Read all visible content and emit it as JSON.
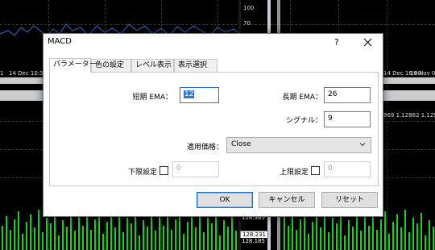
{
  "background": {
    "time_axis": [
      "1",
      "14 Dec 10:59",
      "14 Dec 16:00",
      "28 Nov 0"
    ],
    "right_strip": "969 1.12862 1.129",
    "indicator_scale": [
      "100",
      "70"
    ],
    "price_scale": [
      "128.385",
      "128.231",
      "128.185"
    ]
  },
  "dialog": {
    "title": "MACD",
    "help_label": "?",
    "tabs": [
      "パラメーター",
      "色の設定",
      "レベル表示",
      "表示選択"
    ],
    "fields": {
      "short_ema": {
        "label": "短期 EMA：",
        "value": "12"
      },
      "long_ema": {
        "label": "長期 EMA：",
        "value": "26"
      },
      "signal": {
        "label": "シグナル：",
        "value": "9"
      },
      "apply_price": {
        "label": "適用価格：",
        "value": "Close"
      },
      "lower_limit": {
        "label": "下限設定",
        "value": "0"
      },
      "upper_limit": {
        "label": "上限設定",
        "value": "0"
      }
    },
    "buttons": {
      "ok": "OK",
      "cancel": "キャンセル",
      "reset": "リセット"
    }
  }
}
